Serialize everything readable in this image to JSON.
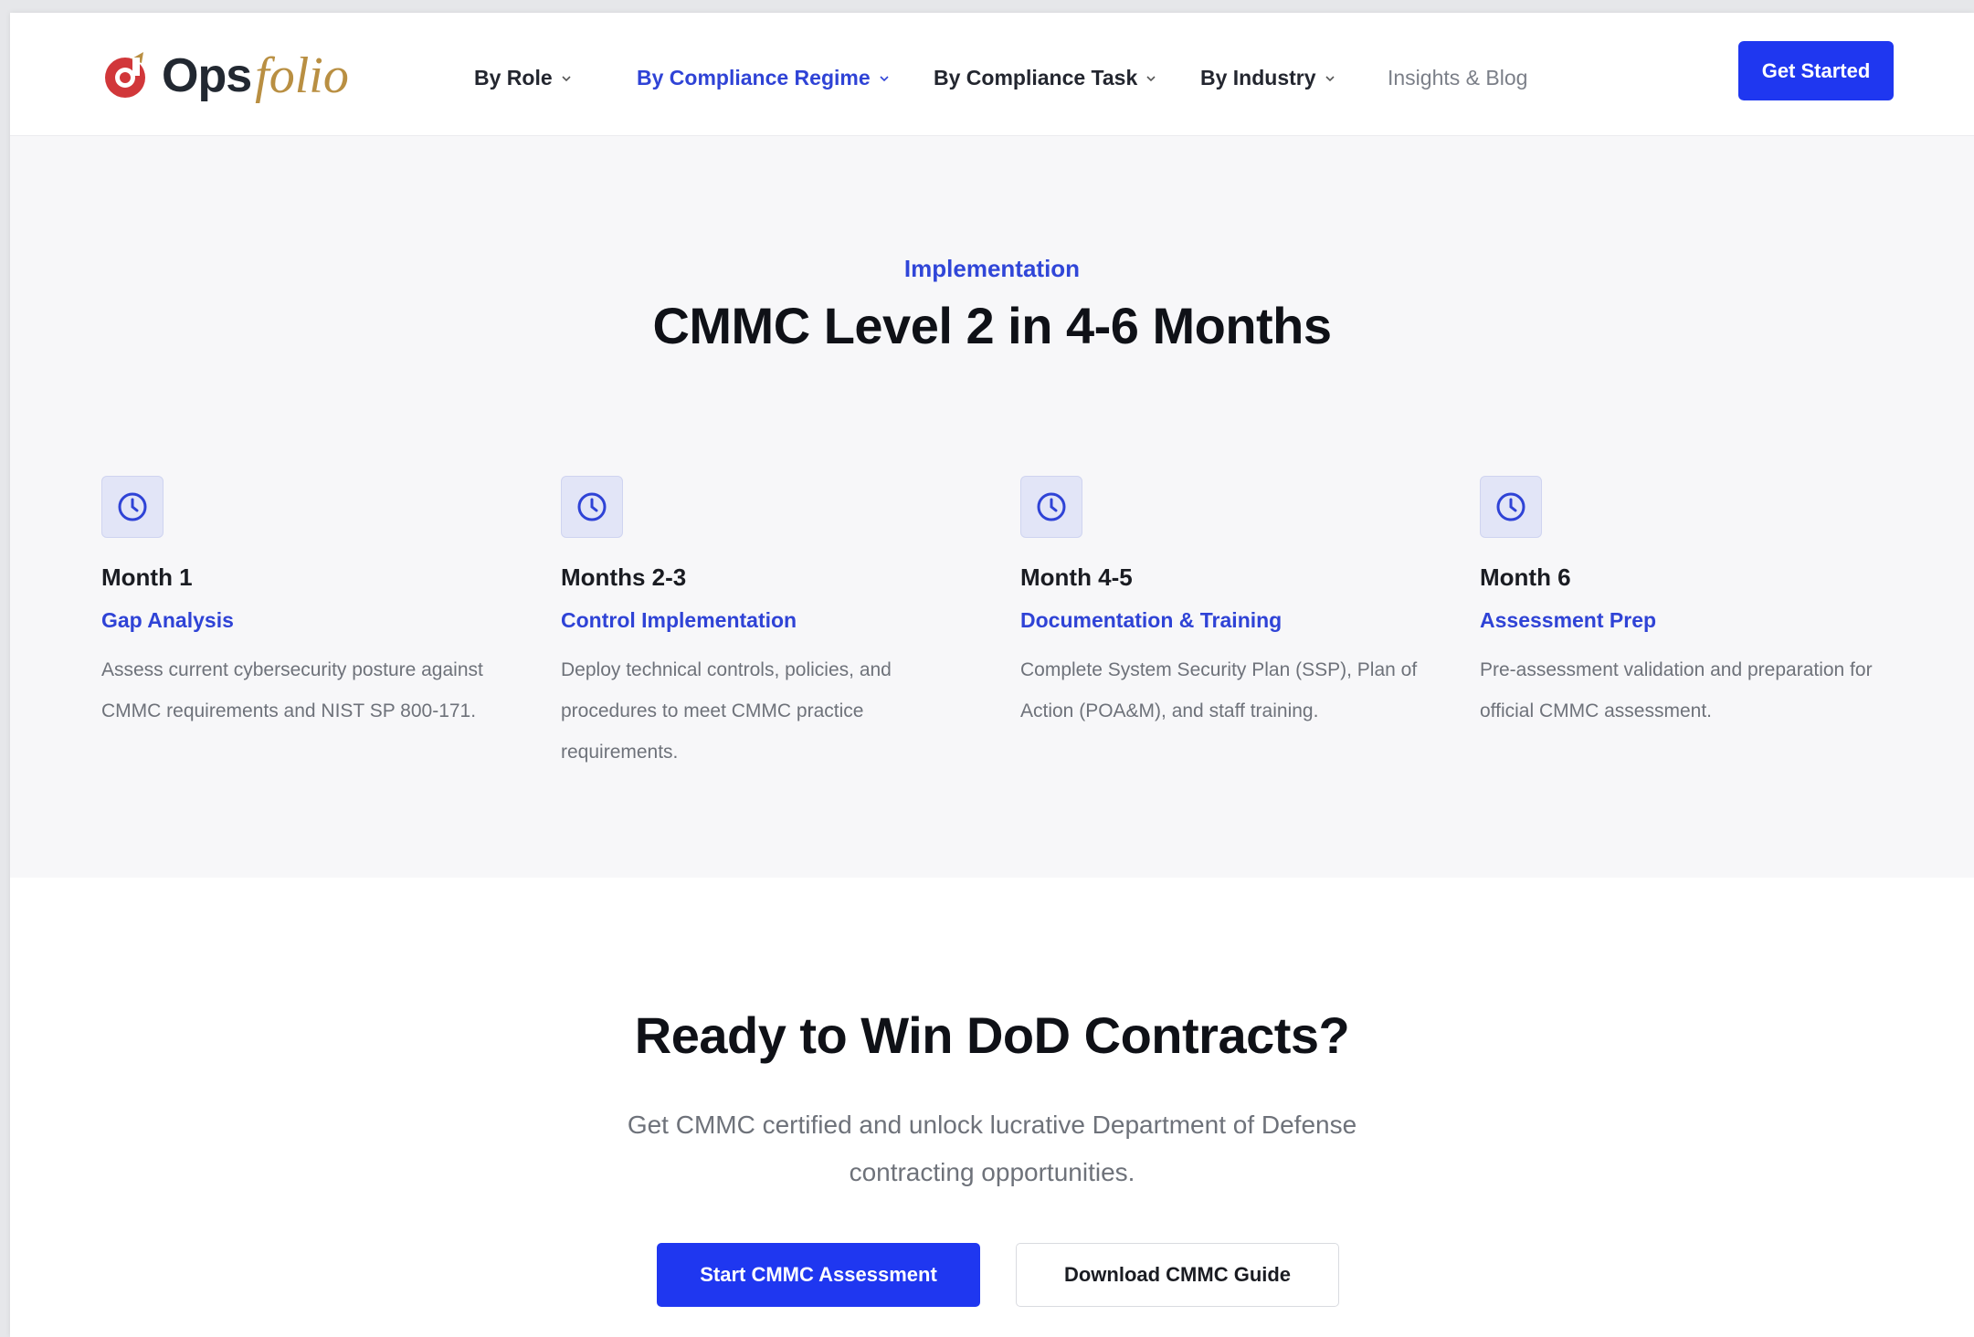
{
  "header": {
    "logo": {
      "text_ops": "Ops",
      "text_folio": "folio"
    },
    "nav": [
      {
        "label": "By Role",
        "has_dropdown": true,
        "active": false
      },
      {
        "label": "By Compliance Regime",
        "has_dropdown": true,
        "active": true
      },
      {
        "label": "By Compliance Task",
        "has_dropdown": true,
        "active": false
      },
      {
        "label": "By Industry",
        "has_dropdown": true,
        "active": false
      },
      {
        "label": "Insights & Blog",
        "has_dropdown": false,
        "active": false
      }
    ],
    "cta_label": "Get Started"
  },
  "timeline": {
    "eyebrow": "Implementation",
    "title": "CMMC Level 2 in 4-6 Months",
    "steps": [
      {
        "icon": "clock-icon",
        "month": "Month 1",
        "phase": "Gap Analysis",
        "description": "Assess current cybersecurity posture against CMMC requirements and NIST SP 800-171."
      },
      {
        "icon": "clock-icon",
        "month": "Months 2-3",
        "phase": "Control Implementation",
        "description": "Deploy technical controls, policies, and procedures to meet CMMC practice requirements."
      },
      {
        "icon": "clock-icon",
        "month": "Month 4-5",
        "phase": "Documentation & Training",
        "description": "Complete System Security Plan (SSP), Plan of Action (POA&M), and staff training."
      },
      {
        "icon": "clock-icon",
        "month": "Month 6",
        "phase": "Assessment Prep",
        "description": "Pre-assessment validation and preparation for official CMMC assessment."
      }
    ]
  },
  "cta": {
    "title": "Ready to Win DoD Contracts?",
    "subtitle": "Get CMMC certified and unlock lucrative Department of Defense contracting opportunities.",
    "primary_label": "Start CMMC Assessment",
    "secondary_label": "Download CMMC Guide"
  },
  "colors": {
    "accent": "#1f37f0",
    "link": "#2f43d6",
    "brand_gold": "#b98f42",
    "brand_red": "#d1373a"
  }
}
